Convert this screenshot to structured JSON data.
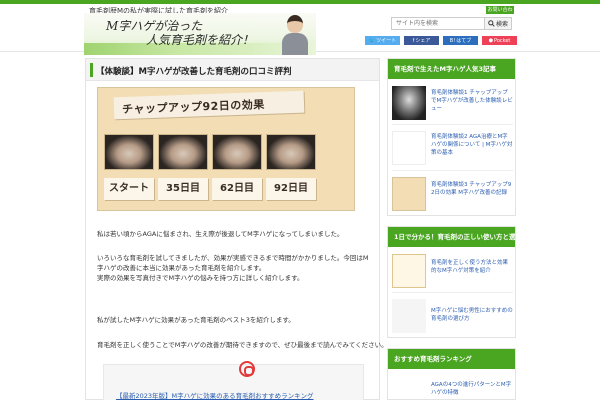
{
  "header": {
    "tagline": "育毛剤歴Mの私が実際に試した育毛剤を紹介",
    "banner_line1": "M字ハゲが治った",
    "banner_line2": "人気育毛剤を紹介！",
    "contact_label": "お問い合わせ",
    "search_placeholder": "サイト内を検索",
    "search_button": "検索",
    "share": {
      "twitter": "ツイート",
      "facebook": "シェア",
      "hatena": "はてブ",
      "pocket": "Pocket"
    }
  },
  "article": {
    "title": "【体験談】M字ハゲが改善した育毛剤の口コミ評判",
    "hero_title": "チャップアップ92日の効果",
    "hero_days": [
      "スタート",
      "35日目",
      "62日目",
      "92日目"
    ],
    "paragraphs": [
      "私は若い頃からAGAに悩まされ、生え際が後退してM字ハゲになってしまいました。",
      "いろいろな育毛剤を試してきましたが、効果が実感できるまで時間がかかりました。今回はM字ハゲの改善に本当に効果があった育毛剤を紹介します。",
      "実際の効果を写真付きでM字ハゲの悩みを持つ方に詳しく紹介します。",
      "私が試したM字ハゲに効果があった育毛剤のベスト3を紹介します。",
      "育毛剤を正しく使うことでM字ハゲの改善が期待できますので、ぜひ最後まで読んでみてください。"
    ],
    "note_link": "【最新2023年版】M字ハゲに効果のある育毛剤おすすめランキング"
  },
  "sidebar": {
    "widgets": [
      {
        "title": "育毛剤で生えたM字ハゲ人気3記事",
        "entries": [
          "育毛剤体験談1 チャップアップでM字ハゲが改善した体験談レビュー",
          "育毛剤体験談2 AGA治療とM字ハゲの関係について | M字ハゲ対策の基本",
          "育毛剤体験談3 チャップアップ92日の効果 M字ハゲ改善の記録"
        ]
      },
      {
        "title": "1日で分かる！育毛剤の正しい使い方と選び方",
        "entries": [
          "育毛剤を正しく使う方法と効果的なM字ハゲ対策を紹介",
          "M字ハゲに悩む男性におすすめの育毛剤の選び方"
        ]
      },
      {
        "title": "おすすめ育毛剤ランキング",
        "entries": [
          "AGAの4つの進行パターンとM字ハゲの特徴"
        ]
      }
    ]
  }
}
